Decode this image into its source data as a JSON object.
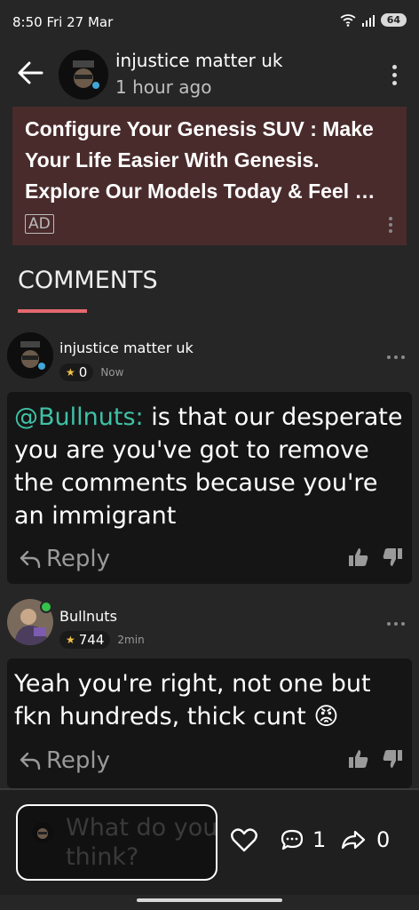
{
  "status": {
    "time": "8:50  Fri 27 Mar",
    "battery": "64"
  },
  "header": {
    "title": "injustice matter uk",
    "subtitle": "1 hour ago"
  },
  "ad": {
    "text": "Configure Your Genesis SUV : Make Your Life Easier With Genesis. Explore Our Models Today & Feel …",
    "badge": "AD"
  },
  "comments_heading": "COMMENTS",
  "comments": [
    {
      "author": "injustice matter uk",
      "rep": "0",
      "time": "Now",
      "mention": "@Bullnuts:",
      "text": " is that our desperate you are you've got to remove the comments because you're an immigrant",
      "reply_label": "Reply"
    },
    {
      "author": "Bullnuts",
      "rep": "744",
      "time": "2min",
      "text": "Yeah you're right, not one but fkn hundreds, thick cunt ",
      "emoji": "😡",
      "reply_label": "Reply"
    }
  ],
  "composer": {
    "placeholder": "What do you think?",
    "comment_count": "1",
    "share_count": "0"
  },
  "colors": {
    "accent": "#e5696f",
    "mention": "#3fc1a6",
    "ad_bg": "#4a2b2c",
    "star": "#f0c24b"
  }
}
